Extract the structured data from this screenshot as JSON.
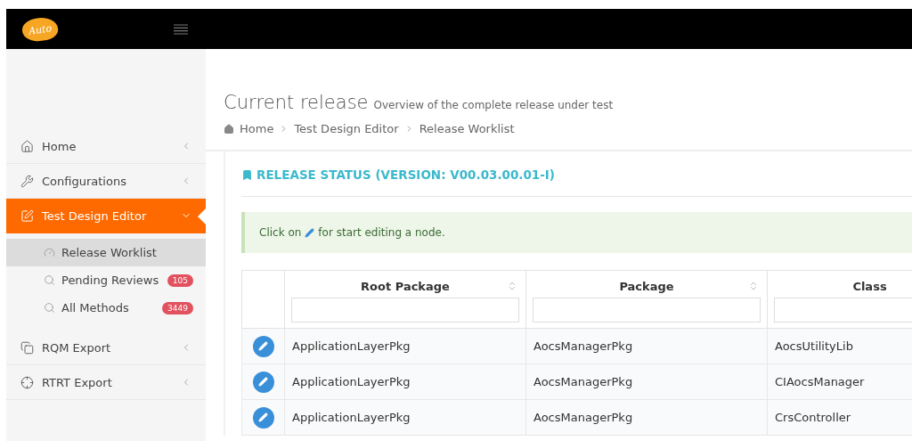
{
  "header": {
    "logo": "Auto"
  },
  "sidebar": {
    "items": [
      {
        "label": "Home",
        "selected": false,
        "expanded": false
      },
      {
        "label": "Configurations",
        "selected": false,
        "expanded": false
      },
      {
        "label": "Test Design Editor",
        "selected": true,
        "expanded": true,
        "children": [
          {
            "label": "Release Worklist",
            "selected": true
          },
          {
            "label": "Pending Reviews",
            "selected": false,
            "badge": "105"
          },
          {
            "label": "All Methods",
            "selected": false,
            "badge": "3449"
          }
        ]
      },
      {
        "label": "RQM Export",
        "selected": false,
        "expanded": false
      },
      {
        "label": "RTRT Export",
        "selected": false,
        "expanded": false
      }
    ]
  },
  "page": {
    "title": "Current release",
    "subtitle": "Overview of the complete release under test",
    "breadcrumb": [
      "Home",
      "Test Design Editor",
      "Release Worklist"
    ]
  },
  "panel": {
    "title": "RELEASE STATUS (VERSION: V00.03.00.01-I)",
    "alert": {
      "before": "Click on",
      "after": "for start editing a node."
    },
    "table": {
      "columns": [
        {
          "label": "Root Package",
          "sortable": true
        },
        {
          "label": "Package",
          "sortable": true
        },
        {
          "label": "Class"
        }
      ],
      "rows": [
        [
          "ApplicationLayerPkg",
          "AocsManagerPkg",
          "AocsUtilityLib"
        ],
        [
          "ApplicationLayerPkg",
          "AocsManagerPkg",
          "CIAocsManager"
        ],
        [
          "ApplicationLayerPkg",
          "AocsManagerPkg",
          "CrsController"
        ]
      ]
    }
  }
}
